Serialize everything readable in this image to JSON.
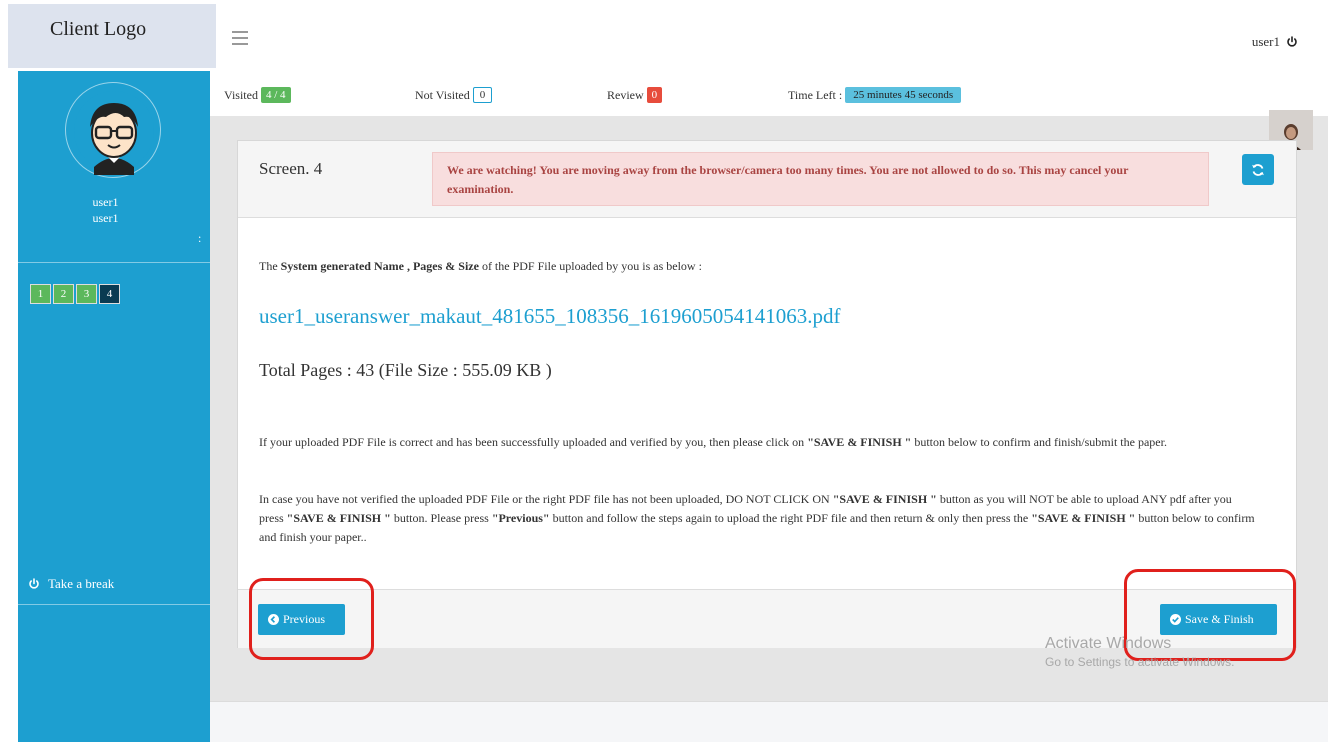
{
  "header": {
    "logo_text": "Client Logo",
    "user_name": "user1"
  },
  "sidebar": {
    "name_line1": "user1",
    "name_line2": "user1",
    "colon": ":",
    "questions": [
      "1",
      "2",
      "3",
      "4"
    ],
    "break_label": "Take a break"
  },
  "status": {
    "visited_label": "Visited",
    "visited_value": "4 / 4",
    "not_visited_label": "Not Visited",
    "not_visited_value": "0",
    "review_label": "Review",
    "review_value": "0",
    "time_left_label": "Time Left :",
    "time_left_value": "25 minutes 45 seconds"
  },
  "panel": {
    "title": "Screen. 4",
    "alert": "We are watching! You are moving away from the browser/camera too many times. You are not allowed to do so. This may cancel your examination.",
    "intro_prefix": "The ",
    "intro_bold": "System generated Name , Pages & Size",
    "intro_suffix": " of the PDF File uploaded by you is as below :",
    "filename": "user1_useranswer_makaut_481655_108356_1619605054141063.pdf",
    "pages": "Total Pages : 43 (File Size : 555.09 KB )",
    "para1_a": "If your uploaded PDF File is correct and has been successfully uploaded and verified by you, then please click on ",
    "para1_bold": "\"SAVE & FINISH \"",
    "para1_b": " button below to confirm and finish/submit the paper.",
    "para2_a": "In case you have not verified the uploaded PDF File or the right PDF file has not been uploaded, DO NOT CLICK ON ",
    "para2_bold1": "\"SAVE & FINISH \"",
    "para2_b": " button as you will NOT be able to upload ANY pdf after you press ",
    "para2_bold2": "\"SAVE & FINISH \"",
    "para2_c": " button. Please press ",
    "para2_bold3": "\"Previous\"",
    "para2_d": " button and follow the steps again to upload the right PDF file and then return & only then press the ",
    "para2_bold4": "\"SAVE & FINISH \"",
    "para2_e": " button below to confirm and finish your paper..",
    "prev_label": "Previous",
    "save_label": "Save & Finish"
  },
  "watermark": {
    "line1": "Activate Windows",
    "line2": "Go to Settings to activate Windows."
  },
  "colors": {
    "accent": "#1d9fd0",
    "success": "#5cb85c",
    "danger": "#e74c3c",
    "alert_bg": "#f8dede",
    "alert_text": "#a94442"
  }
}
